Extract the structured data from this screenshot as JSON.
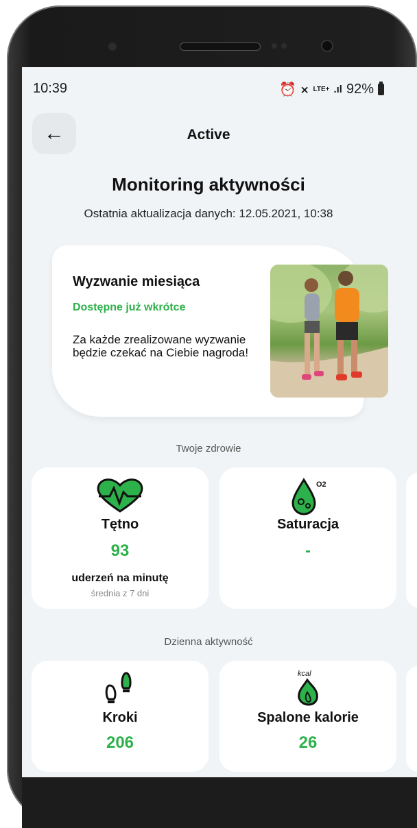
{
  "status_bar": {
    "time": "10:39",
    "network": "LTE+",
    "battery": "92%"
  },
  "header": {
    "title": "Active"
  },
  "page": {
    "title": "Monitoring aktywności",
    "update_line": "Ostatnia aktualizacja danych: 12.05.2021, 10:38"
  },
  "challenge": {
    "title": "Wyzwanie miesiąca",
    "subtitle": "Dostępne już wkrótce",
    "text": "Za każde zrealizowane wyzwanie będzie czekać na Ciebie nagroda!"
  },
  "health": {
    "label": "Twoje zdrowie",
    "heart_rate": {
      "name": "Tętno",
      "value": "93",
      "unit": "uderzeń na minutę",
      "note": "średnia z 7 dni"
    },
    "saturation": {
      "name": "Saturacja",
      "value": "-",
      "icon_text": "O2"
    }
  },
  "activity": {
    "label": "Dzienna aktywność",
    "steps": {
      "name": "Kroki",
      "value": "206"
    },
    "calories": {
      "name": "Spalone kalorie",
      "value": "26",
      "icon_text": "kcal"
    }
  },
  "colors": {
    "accent": "#2db14a",
    "background": "#f1f4f6"
  }
}
